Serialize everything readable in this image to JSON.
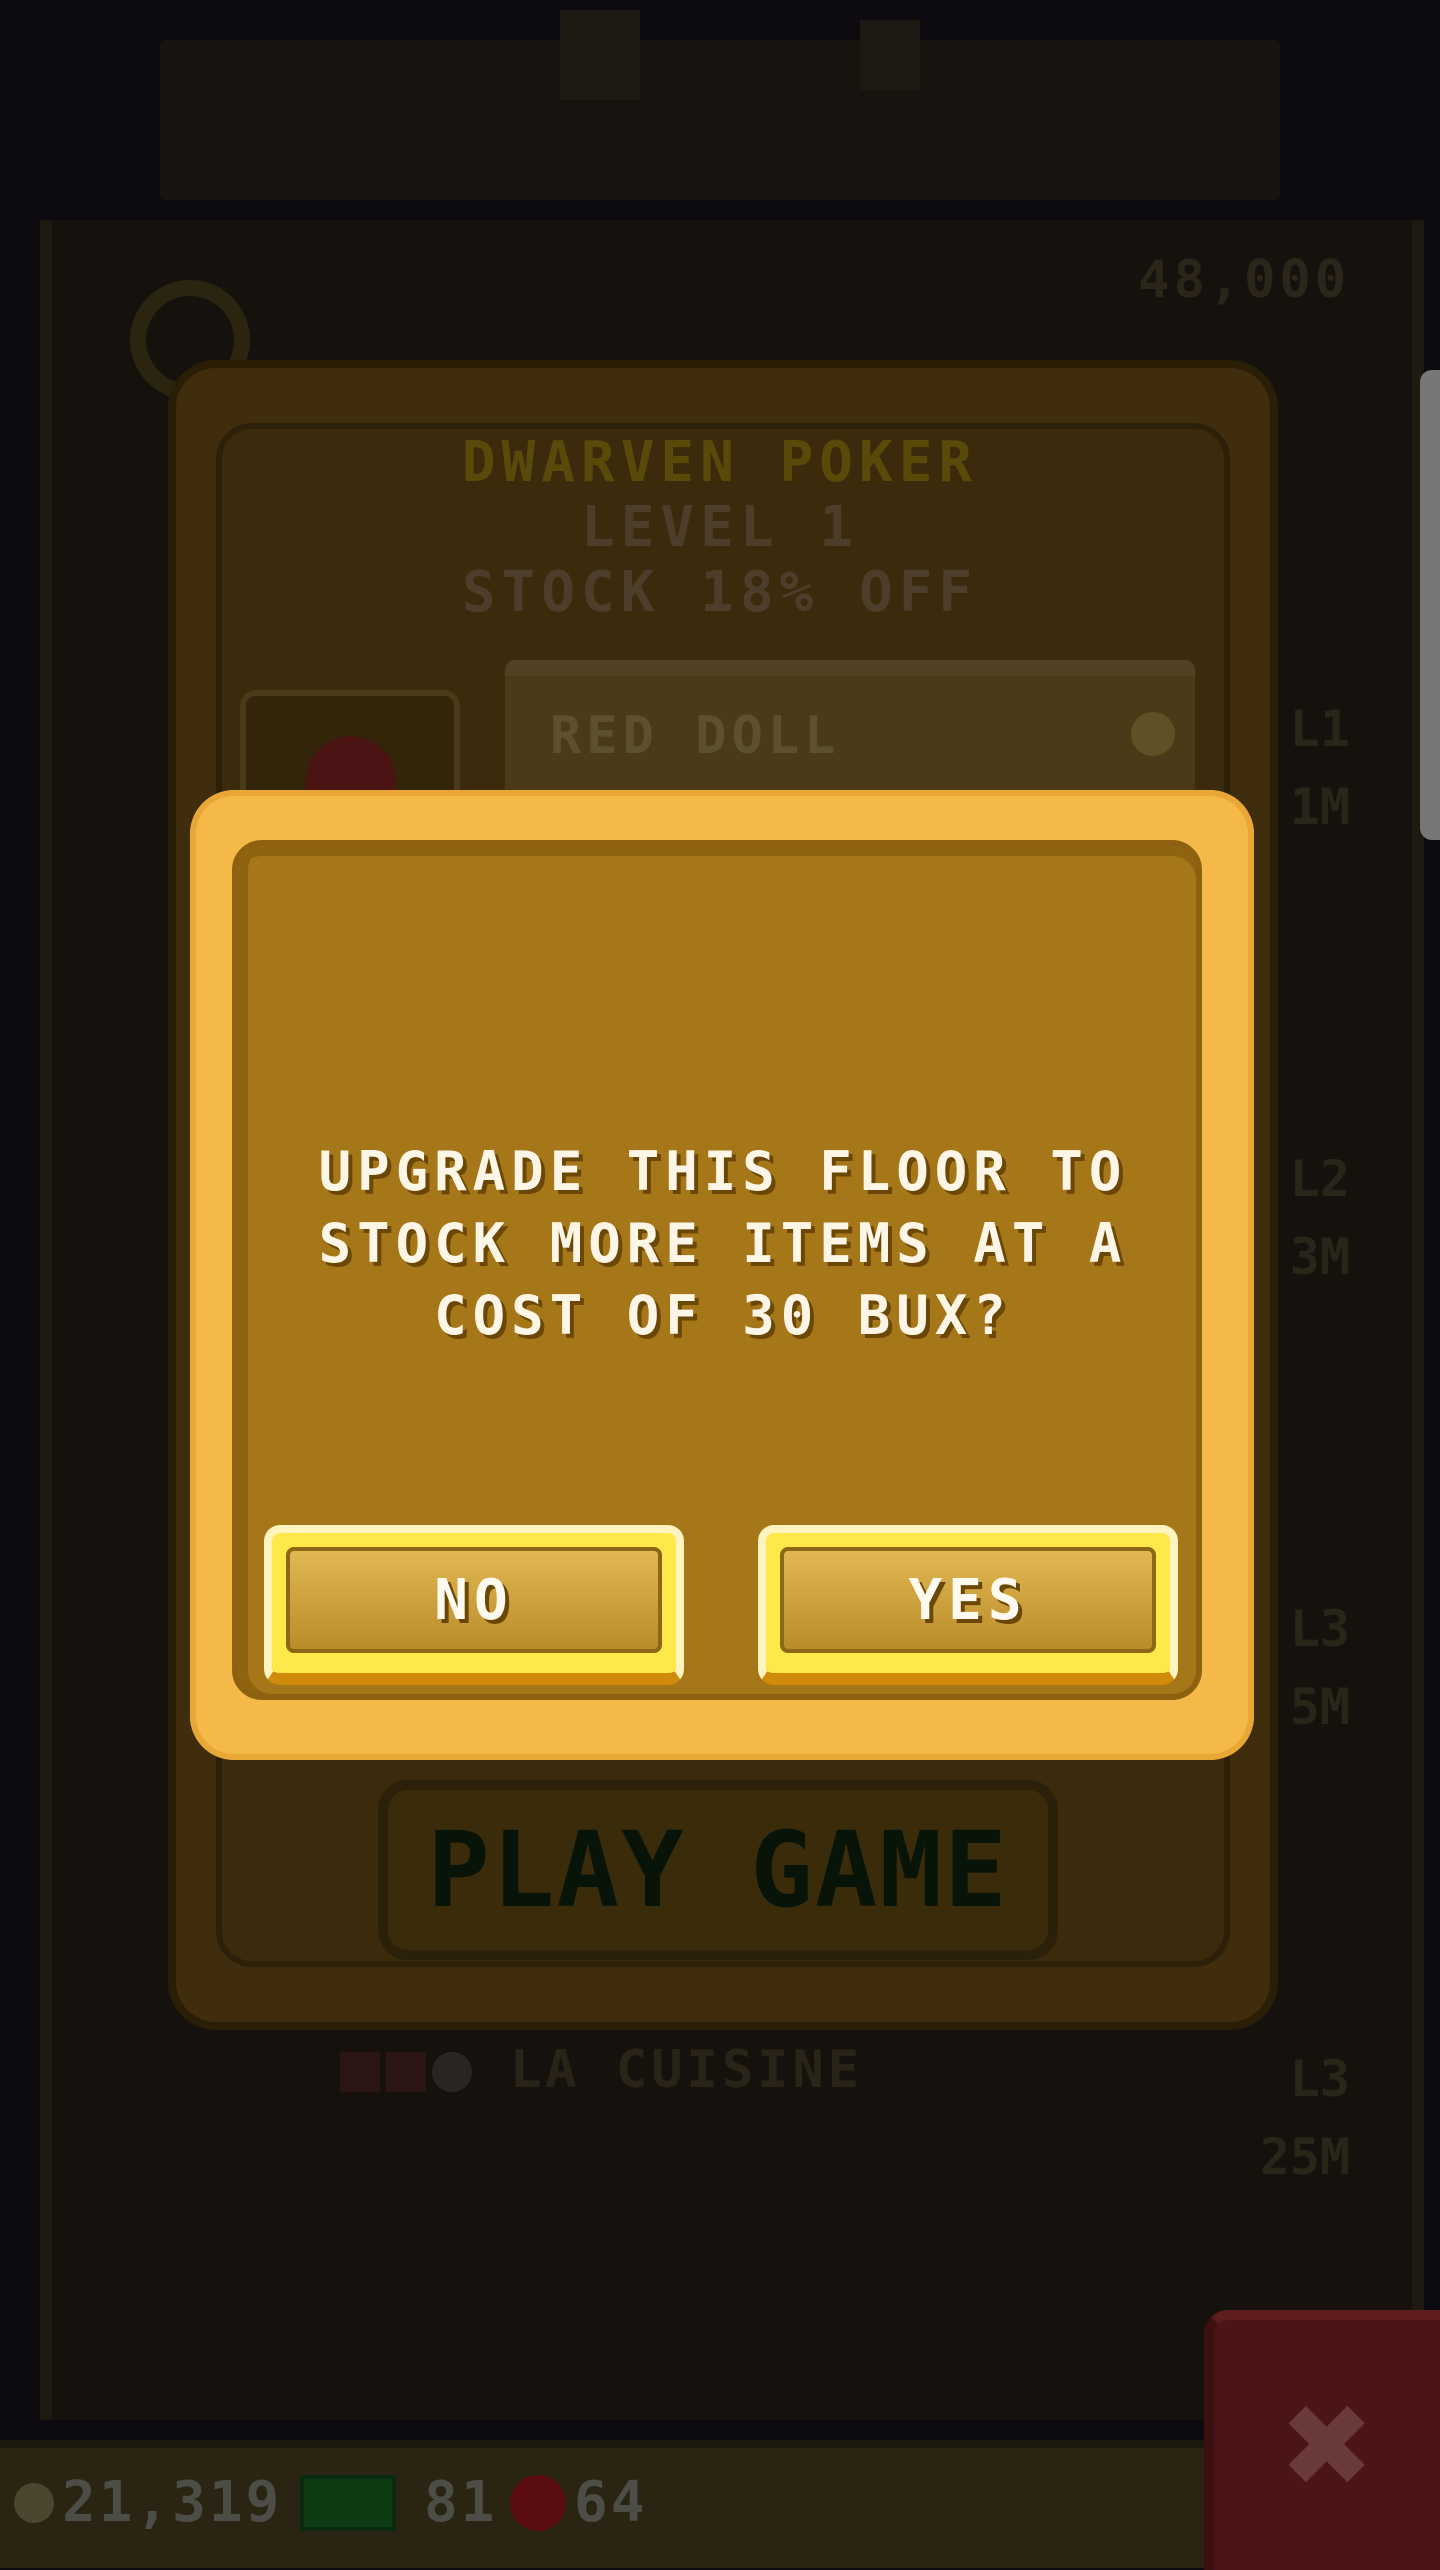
{
  "background": {
    "top_price": "48,000",
    "floor_bottom_name": "LA CUISINE",
    "right_labels": [
      {
        "level": "L1",
        "value": "1M"
      },
      {
        "level": "L2",
        "value": "3M"
      },
      {
        "level": "L3",
        "value": "5M"
      },
      {
        "level": "L3",
        "value": "25M"
      }
    ]
  },
  "floor_panel": {
    "name": "DWARVEN POKER",
    "level": "LEVEL 1",
    "stock": "STOCK 18% OFF",
    "item_name": "RED DOLL",
    "play_button": "PLAY GAME"
  },
  "dialog": {
    "message": "UPGRADE THIS FLOOR TO STOCK MORE ITEMS AT A COST OF 30 BUX?",
    "no_label": "NO",
    "yes_label": "YES"
  },
  "bottom_bar": {
    "coins": "21,319",
    "bux": "81",
    "tickets": "64",
    "close_label": "✖"
  },
  "colors": {
    "dialog_outer": "#f5b94a",
    "dialog_inner": "#a57718",
    "button_glow": "#ffe84a",
    "play_text": "#091409"
  }
}
